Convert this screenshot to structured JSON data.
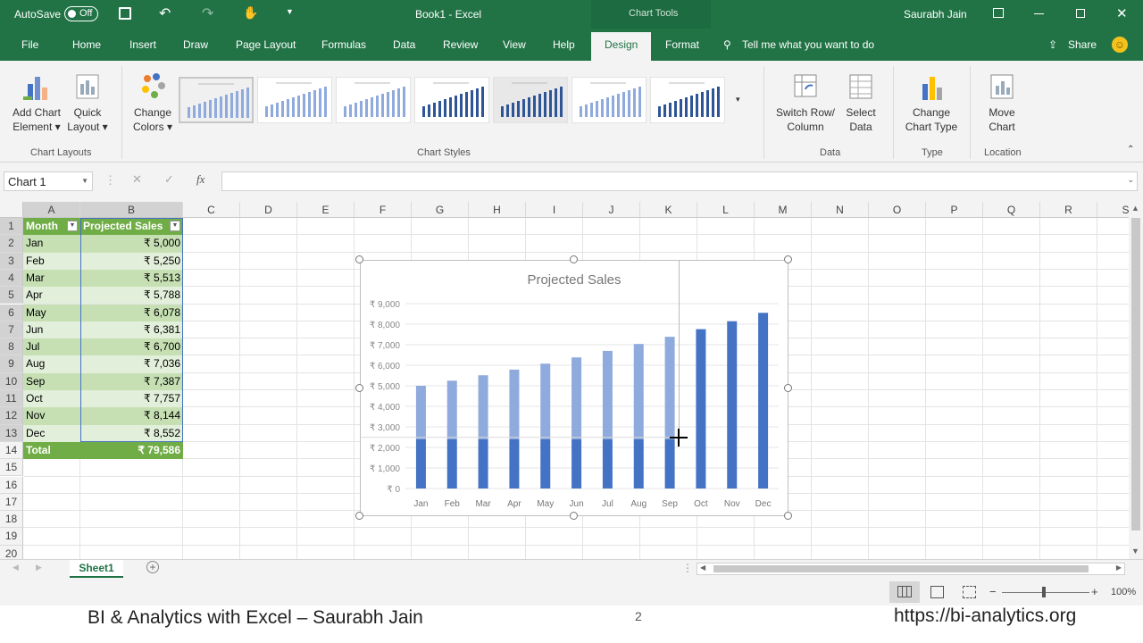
{
  "titlebar": {
    "autosave_label": "AutoSave",
    "autosave_state": "Off",
    "doc_title": "Book1  -  Excel",
    "context_label": "Chart Tools",
    "user": "Saurabh Jain"
  },
  "tabs": [
    "File",
    "Home",
    "Insert",
    "Draw",
    "Page Layout",
    "Formulas",
    "Data",
    "Review",
    "View",
    "Help",
    "Design",
    "Format"
  ],
  "active_tab": "Design",
  "tell_me": "Tell me what you want to do",
  "share": "Share",
  "ribbon": {
    "add_chart_element": [
      "Add Chart",
      "Element"
    ],
    "quick_layout": [
      "Quick",
      "Layout"
    ],
    "change_colors": [
      "Change",
      "Colors"
    ],
    "switch_row_col": [
      "Switch Row/",
      "Column"
    ],
    "select_data": [
      "Select",
      "Data"
    ],
    "change_chart_type": [
      "Change",
      "Chart Type"
    ],
    "move_chart": [
      "Move",
      "Chart"
    ],
    "groups": {
      "chart_layouts": "Chart Layouts",
      "chart_styles": "Chart Styles",
      "data": "Data",
      "type": "Type",
      "location": "Location"
    }
  },
  "formula": {
    "name_box": "Chart 1",
    "fx": "fx"
  },
  "columns": [
    "A",
    "B",
    "C",
    "D",
    "E",
    "F",
    "G",
    "H",
    "I",
    "J",
    "K",
    "L",
    "M",
    "N",
    "O",
    "P",
    "Q",
    "R",
    "S"
  ],
  "rows": [
    "1",
    "2",
    "3",
    "4",
    "5",
    "6",
    "7",
    "8",
    "9",
    "10",
    "11",
    "12",
    "13",
    "14",
    "15",
    "16",
    "17",
    "18",
    "19",
    "20"
  ],
  "table": {
    "headers": [
      "Month",
      "Projected Sales"
    ],
    "data": [
      [
        "Jan",
        "₹ 5,000"
      ],
      [
        "Feb",
        "₹ 5,250"
      ],
      [
        "Mar",
        "₹ 5,513"
      ],
      [
        "Apr",
        "₹ 5,788"
      ],
      [
        "May",
        "₹ 6,078"
      ],
      [
        "Jun",
        "₹ 6,381"
      ],
      [
        "Jul",
        "₹ 6,700"
      ],
      [
        "Aug",
        "₹ 7,036"
      ],
      [
        "Sep",
        "₹ 7,387"
      ],
      [
        "Oct",
        "₹ 7,757"
      ],
      [
        "Nov",
        "₹ 8,144"
      ],
      [
        "Dec",
        "₹ 8,552"
      ]
    ],
    "total": [
      "Total",
      "₹ 79,586"
    ]
  },
  "chart_data": {
    "type": "bar",
    "title": "Projected Sales",
    "categories": [
      "Jan",
      "Feb",
      "Mar",
      "Apr",
      "May",
      "Jun",
      "Jul",
      "Aug",
      "Sep",
      "Oct",
      "Nov",
      "Dec"
    ],
    "values": [
      5000,
      5250,
      5513,
      5788,
      6078,
      6381,
      6700,
      7036,
      7387,
      7757,
      8144,
      8552
    ],
    "ylim": [
      0,
      9000
    ],
    "yticks": [
      "₹ 0",
      "₹ 1,000",
      "₹ 2,000",
      "₹ 3,000",
      "₹ 4,000",
      "₹ 5,000",
      "₹ 6,000",
      "₹ 7,000",
      "₹ 8,000",
      "₹ 9,000"
    ],
    "grid": true,
    "legend": "none",
    "bar_color": "#4472c4",
    "faded_color": "#8faadc"
  },
  "sheet": {
    "tab": "Sheet1"
  },
  "status": {
    "zoom": "100%"
  },
  "footer": {
    "left": "BI & Analytics with Excel – Saurabh Jain",
    "page": "2",
    "right": "https://bi-analytics.org"
  },
  "colors": {
    "excel_green": "#217346",
    "header_green": "#70ad47",
    "row_light": "#e2efda",
    "row_mid": "#c6e0b4"
  }
}
